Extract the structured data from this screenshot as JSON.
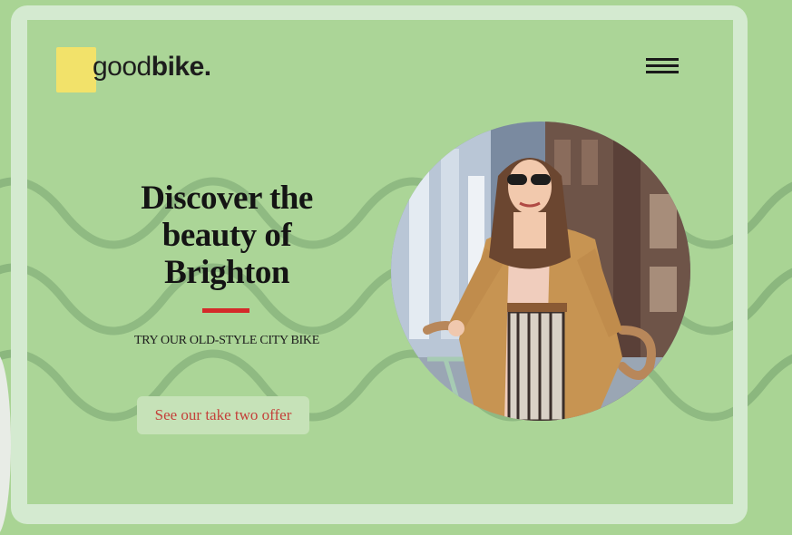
{
  "brand": {
    "name_light": "good",
    "name_bold": "bike.",
    "accent_color": "#f2e26a"
  },
  "header": {
    "menu_icon": "hamburger-menu-icon"
  },
  "hero": {
    "headline": "Discover the beauty of Brighton",
    "accent_color": "#d42a2a",
    "subheadline": "TRY OUR OLD-STYLE CITY BIKE",
    "cta_label": "See our take two offer",
    "cta_text_color": "#c4403a",
    "image": "woman-with-bicycle-photo"
  },
  "colors": {
    "background": "#abd597",
    "frame": "#d4ead0"
  }
}
